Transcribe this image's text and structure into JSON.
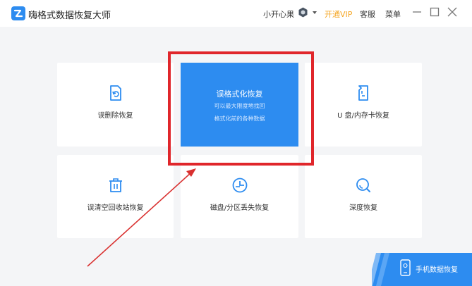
{
  "app": {
    "title": "嗨格式数据恢复大师"
  },
  "header": {
    "user_name": "小开心果",
    "vip_label": "开通VIP",
    "service_label": "客服",
    "menu_label": "菜单"
  },
  "cards": {
    "deleted": {
      "label": "误删除恢复",
      "icon": "file-restore-icon"
    },
    "format": {
      "title": "误格式化恢复",
      "line1": "可以最大限度地找回",
      "line2": "格式化前的各种数据"
    },
    "usb": {
      "label": "U 盘/内存卡恢复",
      "icon": "sd-card-icon"
    },
    "recycle": {
      "label": "误清空回收站恢复",
      "icon": "trash-icon"
    },
    "partition": {
      "label": "磁盘/分区丢失恢复",
      "icon": "pie-chart-icon"
    },
    "deep": {
      "label": "深度恢复",
      "icon": "magnifier-icon"
    }
  },
  "mobile": {
    "label": "手机数据恢复"
  },
  "colors": {
    "accent": "#2d8cf0",
    "vip": "#f5a623",
    "annotation": "#e0262b"
  }
}
